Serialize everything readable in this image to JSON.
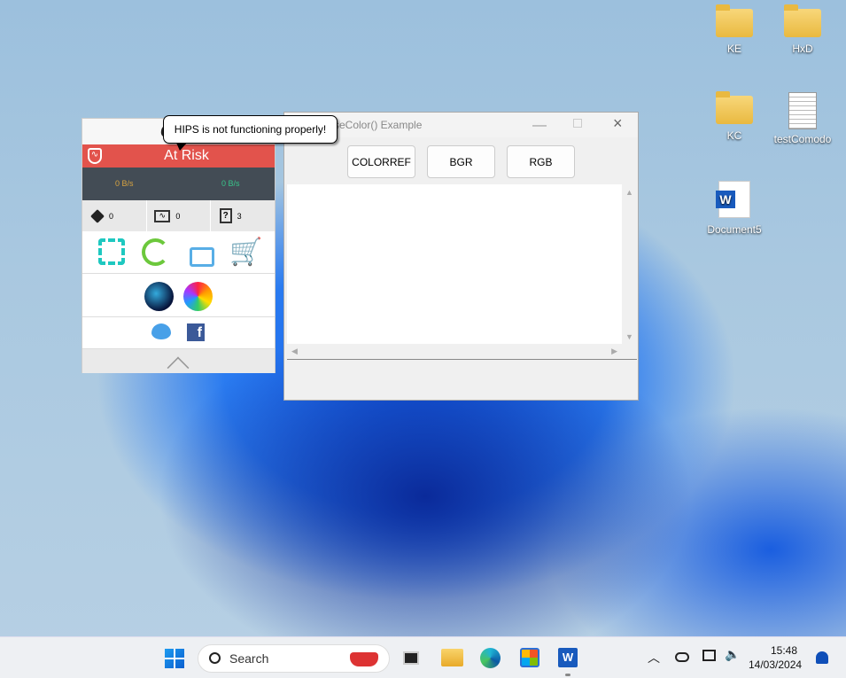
{
  "desktop_icons": [
    {
      "label": "KE"
    },
    {
      "label": "HxD"
    },
    {
      "label": "KC"
    },
    {
      "label": "testComodo"
    },
    {
      "label": "Document5"
    }
  ],
  "comodo": {
    "logo": "CO",
    "status": "At Risk",
    "tooltip": "HIPS is not functioning properly!",
    "download_rate": "0 B/s",
    "upload_rate": "0 B/s",
    "stats": [
      {
        "icon": "sandbox-box-icon",
        "value": "0"
      },
      {
        "icon": "activity-monitor-icon",
        "value": "0"
      },
      {
        "icon": "unknown-file-icon",
        "value": "3"
      }
    ],
    "colors": {
      "risk": "#e2534c",
      "dark": "#434c55",
      "download": "#d9a441",
      "upload": "#38c48a"
    }
  },
  "app_window": {
    "title": "seColor() Example",
    "buttons": [
      "COLORREF",
      "BGR",
      "RGB"
    ]
  },
  "taskbar": {
    "search_placeholder": "Search",
    "time": "15:48",
    "date": "14/03/2024"
  }
}
